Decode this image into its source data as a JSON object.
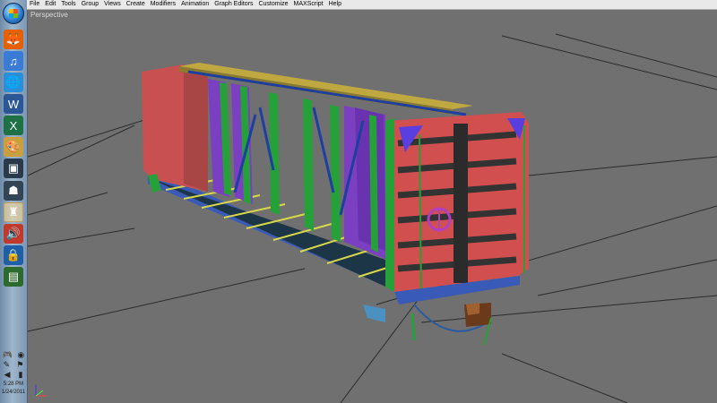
{
  "menu": [
    "File",
    "Edit",
    "Tools",
    "Group",
    "Views",
    "Create",
    "Modifiers",
    "Animation",
    "Graph Editors",
    "Customize",
    "MAXScript",
    "Help"
  ],
  "viewport": {
    "label": "Perspective"
  },
  "taskbar": {
    "apps": [
      {
        "name": "firefox",
        "glyph": "🦊",
        "color": "#e66000"
      },
      {
        "name": "itunes",
        "glyph": "♫",
        "color": "#3a7bd5"
      },
      {
        "name": "globe",
        "glyph": "🌐",
        "color": "#2a8fd8"
      },
      {
        "name": "word",
        "glyph": "W",
        "color": "#2b5797"
      },
      {
        "name": "excel",
        "glyph": "X",
        "color": "#1e7145"
      },
      {
        "name": "paint",
        "glyph": "🎨",
        "color": "#c8a040"
      },
      {
        "name": "3dsmax",
        "glyph": "▣",
        "color": "#2a3a4a"
      },
      {
        "name": "character-app",
        "glyph": "☗",
        "color": "#334455"
      },
      {
        "name": "active-app",
        "glyph": "♜",
        "color": "#7a4a10"
      },
      {
        "name": "speaker",
        "glyph": "🔊",
        "color": "#c0392b"
      },
      {
        "name": "lock-app",
        "glyph": "🔒",
        "color": "#1f5fa8"
      },
      {
        "name": "window-app",
        "glyph": "▤",
        "color": "#2d6a2d"
      }
    ],
    "clock": {
      "time": "5:28 PM",
      "date": "1/24/2011"
    }
  }
}
